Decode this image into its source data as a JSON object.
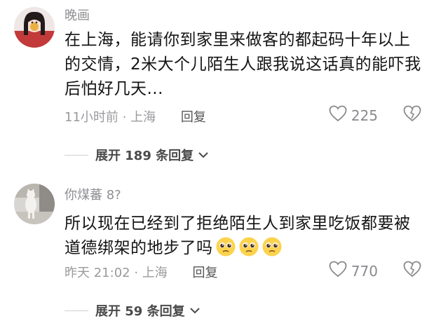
{
  "comments": [
    {
      "username": "晚画",
      "text": "在上海，能请你到家里来做客的都起码十年以上的交情，2米大个儿陌生人跟我说这话真的能吓我后怕好几天...",
      "time_location": "11小时前 · 上海",
      "reply_label": "回复",
      "likes": "225",
      "expand_label": "展开 189 条回复",
      "avatar_icon": "anime-girl-avatar-icon"
    },
    {
      "username": "你煤蕃 8?",
      "text": "所以现在已经到了拒绝陌生人到家里吃饭都要被道德绑架的地步了吗",
      "time_location": "昨天 21:02 · 上海",
      "reply_label": "回复",
      "likes": "770",
      "expand_label": "展开 59 条回复",
      "avatar_icon": "cat-photo-avatar-icon",
      "emojis": [
        "pleading-face-icon",
        "pleading-face-icon",
        "pleading-face-icon"
      ]
    }
  ],
  "colors": {
    "username": "#8e8e93",
    "content": "#141414",
    "meta": "#9a9a9e",
    "expand": "#4a4a4a"
  }
}
